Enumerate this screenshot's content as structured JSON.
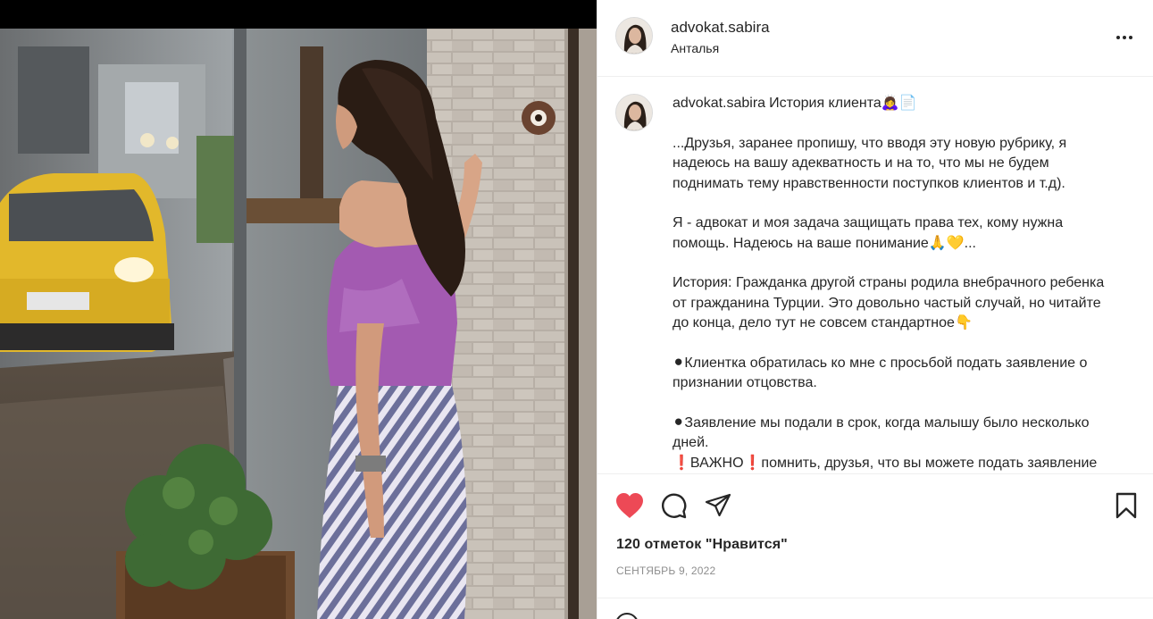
{
  "post": {
    "username": "advokat.sabira",
    "location": "Анталья"
  },
  "caption": {
    "username": "advokat.sabira",
    "title": "История клиента🙇‍♀️📄",
    "paragraphs": [
      "...Друзья, заранее пропишу, что вводя эту новую рубрику, я надеюсь на вашу адекватность и на то, что мы не будем поднимать тему нравственности поступков клиентов и т.д).",
      "Я - адвокат и моя задача защищать права тех, кому нужна помощь. Надеюсь на ваше понимание🙏💛...",
      "История: Гражданка другой страны родила внебрачного ребенка от гражданина Турции. Это довольно частый случай, но читайте до конца, дело тут не совсем стандартное👇",
      "⚫Клиентка обратилась ко мне с просьбой подать заявление о признании отцовства.",
      "⚫Заявление мы подали в срок, когда малышу было несколько дней."
    ],
    "continuation": "❗ВАЖНО❗помнить, друзья, что вы можете подать заявление"
  },
  "actions": {
    "like_icon": "heart-filled-icon",
    "comment_icon": "comment-icon",
    "share_icon": "paper-plane-icon",
    "save_icon": "bookmark-icon",
    "like_color": "#ed4956"
  },
  "likes_text": "120 отметок \"Нравится\"",
  "date_text": "СЕНТЯБРЬ 9, 2022",
  "colors": {
    "text": "#262626",
    "muted": "#8e8e8e",
    "border": "#efefef"
  }
}
